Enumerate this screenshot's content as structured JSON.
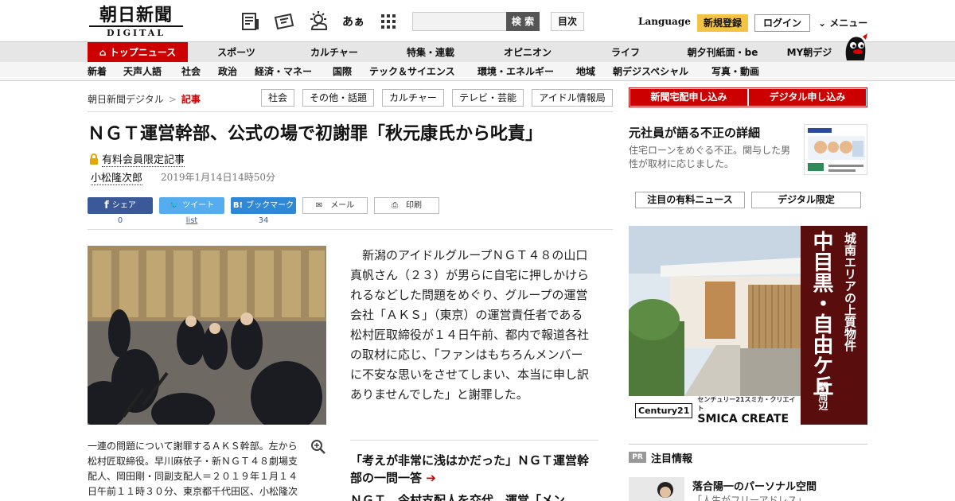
{
  "header": {
    "logo_main": "朝日新聞",
    "logo_sub": "DIGITAL",
    "search_button": "検 索",
    "index_button": "目次",
    "language": "Language",
    "register": "新規登録",
    "login": "ログイン",
    "menu": "メニュー",
    "font_size_glyph": "あぁ"
  },
  "nav_primary": {
    "top": "トップニュース",
    "items": [
      "スポーツ",
      "カルチャー",
      "特集・連載",
      "オピニオン",
      "ライフ",
      "朝夕刊紙面・be",
      "MY朝デジ"
    ]
  },
  "nav_secondary": {
    "items": [
      "新着",
      "天声人語",
      "社会",
      "政治",
      "経済・マネー",
      "国際",
      "テック＆サイエンス",
      "環境・エネルギー",
      "地域",
      "朝デジスペシャル",
      "写真・動画"
    ]
  },
  "breadcrumb": {
    "home": "朝日新聞デジタル",
    "separator": ">",
    "current": "記事"
  },
  "tags": [
    "社会",
    "その他・話題",
    "カルチャー",
    "テレビ・芸能",
    "アイドル情報局"
  ],
  "article": {
    "title": "ＮＧＴ運営幹部、公式の場で初謝罪「秋元康氏から叱責」",
    "paid_label": "有料会員限定記事",
    "author": "小松隆次郎",
    "date": "2019年1月14日14時50分",
    "body": "新潟のアイドルグループＮＧＴ４８の山口真帆さん（２３）が男らに自宅に押しかけられるなどした問題をめぐり、グループの運営会社「ＡＫＳ」（東京）の運営責任者である松村匠取締役が１４日午前、都内で報道各社の取材に応じ、「ファンはもちろんメンバーに不安な思いをさせてしまい、本当に申し訳ありませんでした」と謝罪した。",
    "caption": "一連の問題について謝罪するＡＫＳ幹部。左から松村匠取締役。早川麻依子・新ＮＧＴ４８劇場支配人、岡田剛・同副支配人＝２０１９年１月１４日午前１１時３０分、東京都千代田区、小松隆次",
    "related": [
      "「考えが非常に浅はかだった」ＮＧＴ運営幹部の一問一答",
      "ＮＧＴ、今村支配人を交代　運営「メン"
    ]
  },
  "share": {
    "facebook": {
      "label": "シェア",
      "count": "0"
    },
    "twitter": {
      "label": "ツイート",
      "count": "list"
    },
    "hatena": {
      "label": "ブックマーク",
      "count": "34"
    },
    "mail": "メール",
    "print": "印刷"
  },
  "sidebar": {
    "subscribe_paper": "新聞宅配申し込み",
    "subscribe_digital": "デジタル申し込み",
    "promo_title": "元社員が語る不正の詳細",
    "promo_desc": "住宅ローンをめぐる不正。関与した男性が取材に応じました。",
    "tab_paid": "注目の有料ニュース",
    "tab_digital": "デジタル限定",
    "ad": {
      "line1": "城南エリアの上質物件",
      "line2": "中目黒・自由ケ丘",
      "line3": "駅周辺",
      "brand_jp": "センチュリー21スミカ・クリエイト",
      "brand_en": "SMICA CREATE",
      "brand_mark": "Century21"
    },
    "pr_badge": "PR",
    "pr_label": "注目情報",
    "pr_title": "落合陽一のパーソナル空間",
    "pr_sub": "「人生がフリーアドレス」"
  },
  "colors": {
    "brand_red": "#cc0000",
    "facebook": "#3b5998",
    "twitter": "#55acee",
    "hatena": "#2e88d6",
    "register_yellow": "#f3c443"
  }
}
